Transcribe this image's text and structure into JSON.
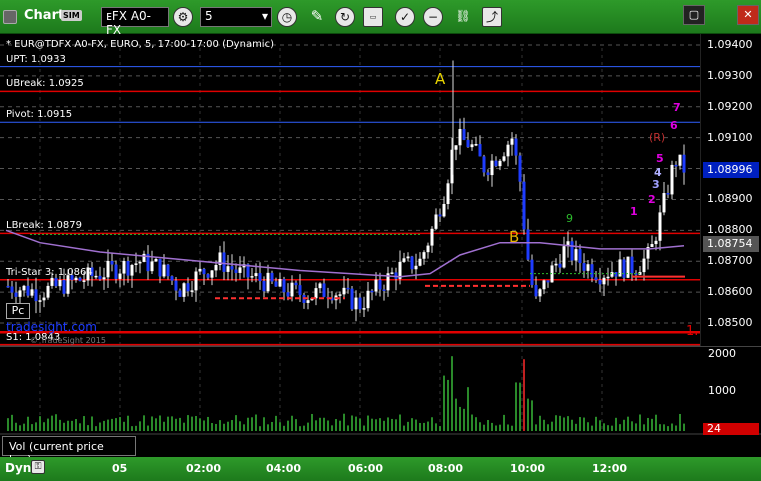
{
  "toolbar": {
    "title": "Chart",
    "sim_badge": "SIM",
    "symbol_value": "ᴇFX A0-FX",
    "interval_value": "5",
    "dropdown_arrow": "▾"
  },
  "chart": {
    "header_text": "* EUR@TDFX A0-FX, EURO, 5, 17:00-17:00 (Dynamic)",
    "levels": [
      {
        "label": "UPT: 1.0933",
        "price": 1.0933,
        "color": "#3060ff"
      },
      {
        "label": "UBreak: 1.0925",
        "price": 1.0925,
        "color": "#e00000"
      },
      {
        "label": "Pivot: 1.0915",
        "price": 1.0915,
        "color": "#3060ff"
      },
      {
        "label": "LBreak: 1.0879",
        "price": 1.0879,
        "color": "#e00000"
      },
      {
        "label": "Tri-Star 3: 1.0864",
        "price": 1.0864,
        "color": "#e00000"
      },
      {
        "label": "S1: 1.0843",
        "price": 1.0843,
        "color": "#e00000"
      }
    ],
    "price_ticks": [
      "1.09400",
      "1.09300",
      "1.09200",
      "1.09100",
      "1.09000",
      "1.08900",
      "1.08800",
      "1.08700",
      "1.08600",
      "1.08500"
    ],
    "current_price": "1.08996",
    "vwap_price": "1.08754",
    "marker_a": "A",
    "marker_b": "B",
    "marker_r": "(R)",
    "count_labels": [
      "1",
      "2",
      "3",
      "4",
      "5",
      "6",
      "7"
    ],
    "setup_digit": "9",
    "watermark": "tradesight.com",
    "watermark_sub": "© TradeSight 2015",
    "right_edge_text": "1.",
    "pc_label": "Pc",
    "colors": {
      "accent_green": "#2e9a2a",
      "up_candle": "#ffffff",
      "down_candle": "#1e3cff",
      "vwap": "#a070d0"
    }
  },
  "volume": {
    "ticks": [
      "2000",
      "1000"
    ],
    "current": "24",
    "tab_label": "Vol (current price bar)"
  },
  "time_axis": {
    "dyn_label": "Dyn",
    "labels": [
      "05",
      "02:00",
      "04:00",
      "06:00",
      "08:00",
      "10:00",
      "12:00"
    ]
  }
}
